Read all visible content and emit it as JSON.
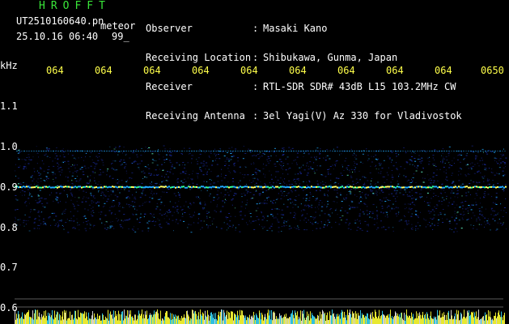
{
  "header": {
    "title": "HROFFT",
    "filename": "UT2510160640.pn",
    "meteor_label": "meteor",
    "datetime": "25.10.16 06:40",
    "count": "99_",
    "fields": [
      {
        "label": "Observer",
        "value": "Masaki Kano"
      },
      {
        "label": "Receiving Location",
        "value": "Shibukawa, Gunma, Japan"
      },
      {
        "label": "Receiver",
        "value": "RTL-SDR SDR# 43dB L15 103.2MHz CW"
      },
      {
        "label": "Receiving Antenna",
        "value": "3el Yagi(V) Az 330 for Vladivostok"
      }
    ],
    "separator": ":"
  },
  "axes": {
    "y_unit": "kHz",
    "y_ticks": [
      "1.1",
      "1.0",
      "0.9",
      "0.8",
      "0.7",
      "0.6"
    ],
    "x_ticks": [
      "064",
      "064",
      "064",
      "064",
      "064",
      "064",
      "064",
      "064",
      "064",
      "0650"
    ]
  },
  "colors": {
    "background": "#000000",
    "header_text": "#ffffff",
    "time_labels": "#ffff4a",
    "title": "#39e639",
    "signal_low": "#1a2a9a",
    "signal_mid": "#22aaff",
    "signal_high": "#ffff66",
    "grid": "#ffffff"
  }
}
